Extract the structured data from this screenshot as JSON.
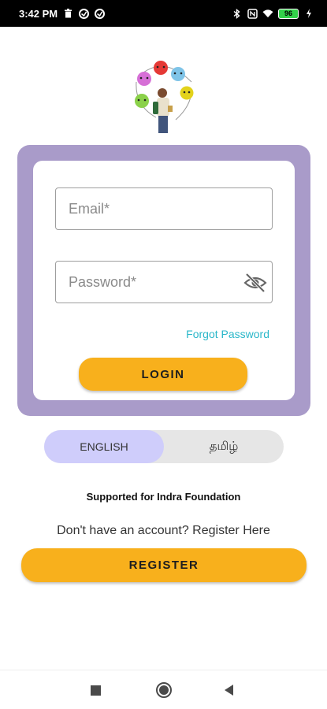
{
  "status_bar": {
    "time": "3:42 PM",
    "battery": "96"
  },
  "login": {
    "email_placeholder": "Email*",
    "password_placeholder": "Password*",
    "forgot_password": "Forgot Password",
    "login_button": "LOGIN"
  },
  "language": {
    "options": [
      "ENGLISH",
      "தமிழ்"
    ],
    "selected": "ENGLISH"
  },
  "footer": {
    "supported": "Supported for Indra Foundation",
    "register_prompt": "Don't have an account? Register Here",
    "register_button": "REGISTER"
  },
  "colors": {
    "accent": "#f8b01c",
    "card_border": "#a99bc9",
    "link": "#2ab7c9",
    "language_active": "#cfcdfb"
  },
  "icons": [
    "trash-icon",
    "sync-icon",
    "bluetooth-icon",
    "nfc-icon",
    "wifi-icon",
    "battery-icon",
    "eye-off-icon",
    "nav-recents-icon",
    "nav-home-icon",
    "nav-back-icon"
  ]
}
